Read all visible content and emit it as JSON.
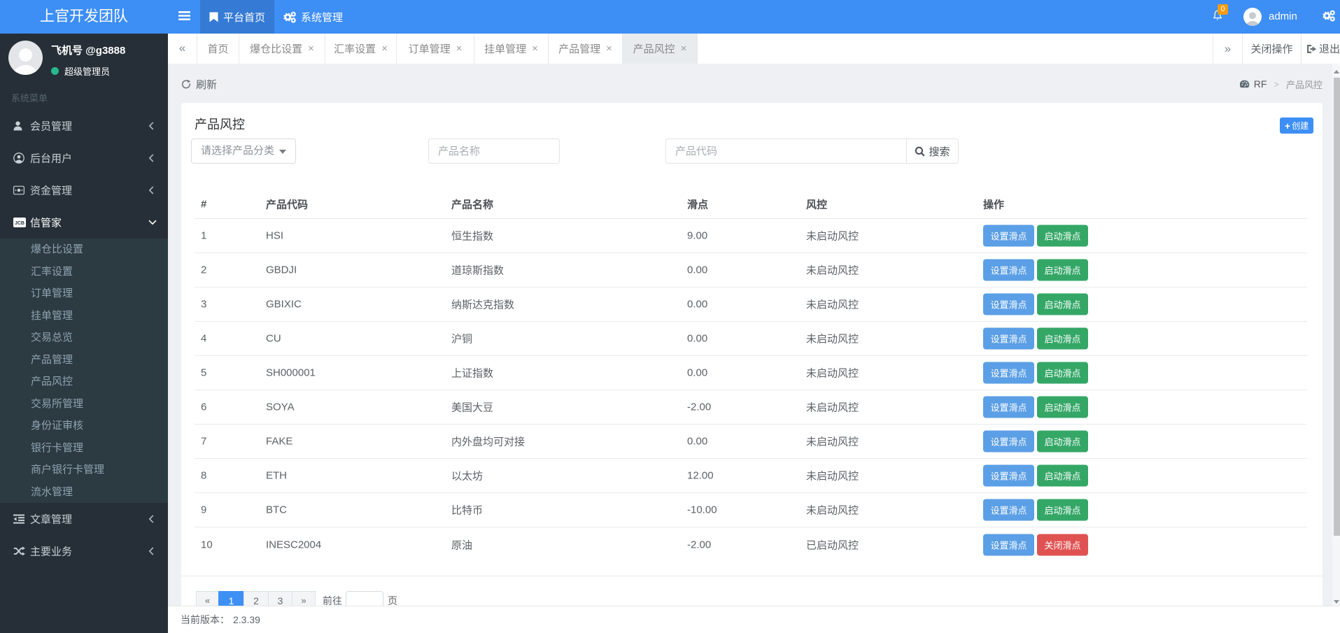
{
  "header": {
    "brand": "上官开发团队",
    "nav_home": "平台首页",
    "nav_system": "系统管理",
    "badge_count": "0",
    "username": "admin"
  },
  "sidebar": {
    "profile_name": "飞机号 @g3888",
    "profile_role": "超级管理员",
    "section_label": "系统菜单",
    "items": [
      {
        "label": "会员管理"
      },
      {
        "label": "后台用户"
      },
      {
        "label": "资金管理"
      },
      {
        "label": "信管家"
      },
      {
        "label": "文章管理"
      },
      {
        "label": "主要业务"
      }
    ],
    "submenu": [
      {
        "label": "爆仓比设置"
      },
      {
        "label": "汇率设置"
      },
      {
        "label": "订单管理"
      },
      {
        "label": "挂单管理"
      },
      {
        "label": "交易总览"
      },
      {
        "label": "产品管理"
      },
      {
        "label": "产品风控"
      },
      {
        "label": "交易所管理"
      },
      {
        "label": "身份证审核"
      },
      {
        "label": "银行卡管理"
      },
      {
        "label": "商户银行卡管理"
      },
      {
        "label": "流水管理"
      }
    ]
  },
  "tabbar": {
    "prev": "«",
    "next": "»",
    "close": "×",
    "tabs": [
      {
        "label": "首页",
        "closable": false
      },
      {
        "label": "爆仓比设置",
        "closable": true
      },
      {
        "label": "汇率设置",
        "closable": true
      },
      {
        "label": "订单管理",
        "closable": true
      },
      {
        "label": "挂单管理",
        "closable": true
      },
      {
        "label": "产品管理",
        "closable": true
      },
      {
        "label": "产品风控",
        "closable": true
      }
    ],
    "close_ops": "关闭操作",
    "logout": "退出"
  },
  "toolbar": {
    "refresh": "刷新"
  },
  "breadcrumb": {
    "root": "RF",
    "sep": ">",
    "current": "产品风控"
  },
  "panel": {
    "title": "产品风控",
    "create_label": "创建",
    "create_plus": "+",
    "category_placeholder": "请选择产品分类",
    "name_placeholder": "产品名称",
    "code_placeholder": "产品代码",
    "search_label": "搜索"
  },
  "table": {
    "headers": [
      "#",
      "产品代码",
      "产品名称",
      "滑点",
      "风控",
      "操作"
    ],
    "rows": [
      {
        "idx": "1",
        "code": "HSI",
        "name": "恒生指数",
        "slip": "9.00",
        "risk": "未启动风控",
        "btn_set": "设置滑点",
        "btn_toggle": "启动滑点"
      },
      {
        "idx": "2",
        "code": "GBDJI",
        "name": "道琼斯指数",
        "slip": "0.00",
        "risk": "未启动风控",
        "btn_set": "设置滑点",
        "btn_toggle": "启动滑点"
      },
      {
        "idx": "3",
        "code": "GBIXIC",
        "name": "纳斯达克指数",
        "slip": "0.00",
        "risk": "未启动风控",
        "btn_set": "设置滑点",
        "btn_toggle": "启动滑点"
      },
      {
        "idx": "4",
        "code": "CU",
        "name": "沪铜",
        "slip": "0.00",
        "risk": "未启动风控",
        "btn_set": "设置滑点",
        "btn_toggle": "启动滑点"
      },
      {
        "idx": "5",
        "code": "SH000001",
        "name": "上证指数",
        "slip": "0.00",
        "risk": "未启动风控",
        "btn_set": "设置滑点",
        "btn_toggle": "启动滑点"
      },
      {
        "idx": "6",
        "code": "SOYA",
        "name": "美国大豆",
        "slip": "-2.00",
        "risk": "未启动风控",
        "btn_set": "设置滑点",
        "btn_toggle": "启动滑点"
      },
      {
        "idx": "7",
        "code": "FAKE",
        "name": "内外盘均可对接",
        "slip": "0.00",
        "risk": "未启动风控",
        "btn_set": "设置滑点",
        "btn_toggle": "启动滑点"
      },
      {
        "idx": "8",
        "code": "ETH",
        "name": "以太坊",
        "slip": "12.00",
        "risk": "未启动风控",
        "btn_set": "设置滑点",
        "btn_toggle": "启动滑点"
      },
      {
        "idx": "9",
        "code": "BTC",
        "name": "比特币",
        "slip": "-10.00",
        "risk": "未启动风控",
        "btn_set": "设置滑点",
        "btn_toggle": "启动滑点"
      },
      {
        "idx": "10",
        "code": "INESC2004",
        "name": "原油",
        "slip": "-2.00",
        "risk": "已启动风控",
        "btn_set": "设置滑点",
        "btn_toggle": "关闭滑点"
      }
    ]
  },
  "pagination": {
    "prev": "«",
    "pages": [
      {
        "label": "1"
      },
      {
        "label": "2"
      },
      {
        "label": "3"
      }
    ],
    "next": "»",
    "active_page": "1",
    "goto_label": "前往",
    "unit_label": "页"
  },
  "footer": {
    "version_label": "当前版本：",
    "version": "2.3.39"
  },
  "colors": {
    "header_blue": "#3d8ef5",
    "sidebar_dark": "#262f37",
    "submenu_dark": "#2c3a42",
    "badge_orange": "#f39c12",
    "status_green": "#28b78d",
    "btn_set_blue": "#5b9fe6",
    "btn_start_green": "#34a767",
    "btn_stop_red": "#e05252",
    "active_page_blue": "#3f90f5"
  }
}
